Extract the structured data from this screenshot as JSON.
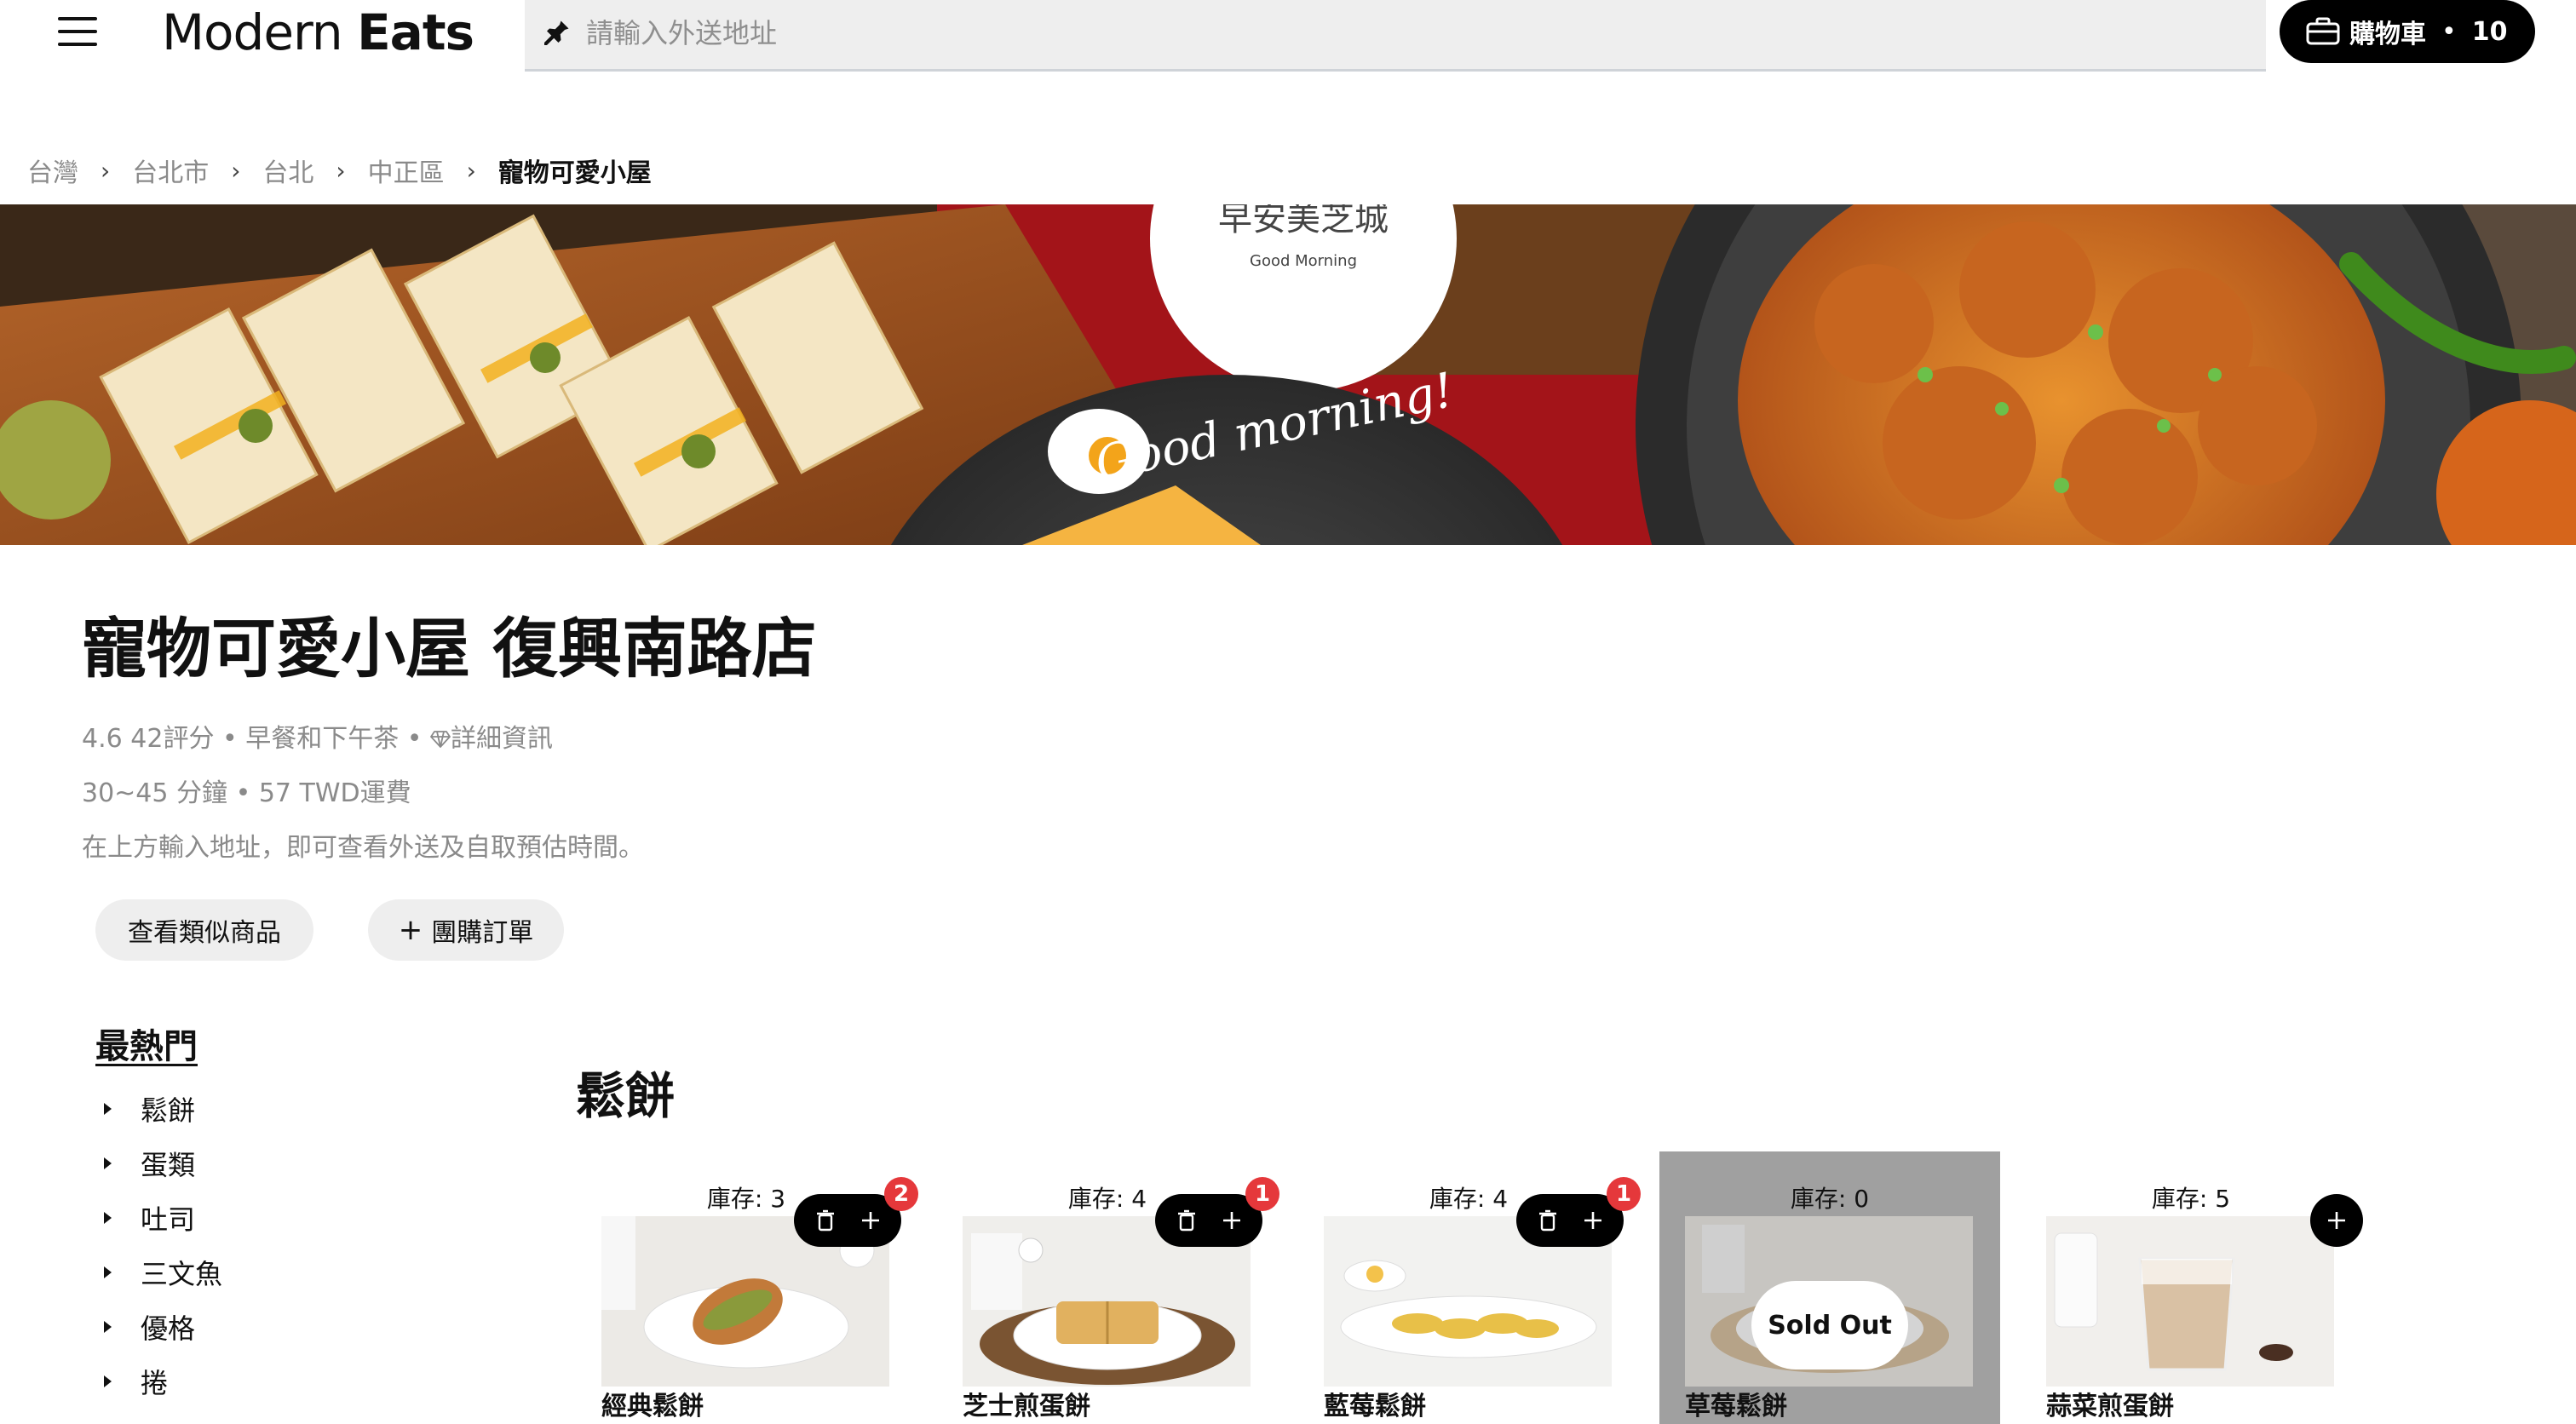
{
  "header": {
    "logo_light": "Modern",
    "logo_bold": "Eats",
    "search_placeholder": "請輸入外送地址",
    "cart_label": "購物車",
    "cart_separator": "•",
    "cart_count": "10"
  },
  "breadcrumb": {
    "items": [
      "台灣",
      "台北市",
      "台北",
      "中正區",
      "寵物可愛小屋"
    ]
  },
  "store": {
    "title": "寵物可愛小屋 復興南路店",
    "rating": "4.6",
    "reviews": "42評分",
    "sep": "•",
    "category": "早餐和下午茶",
    "details_label": "詳細資訊",
    "delivery_time": "30~45 分鐘",
    "delivery_fee": "57 TWD運費",
    "address_hint": "在上方輸入地址，即可查看外送及自取預估時間。"
  },
  "actions": {
    "similar_label": "查看類似商品",
    "group_label": "團購訂單",
    "group_prefix": "+"
  },
  "sidebar": {
    "title": "最熱門",
    "items": [
      {
        "label": "鬆餅"
      },
      {
        "label": "蛋類"
      },
      {
        "label": "吐司"
      },
      {
        "label": "三文魚"
      },
      {
        "label": "優格"
      },
      {
        "label": "捲"
      }
    ]
  },
  "section": {
    "title": "鬆餅",
    "sold_out_label": "Sold Out",
    "items": [
      {
        "name": "經典鬆餅",
        "stock": "庫存: 3",
        "in_cart": "2",
        "sold_out": false
      },
      {
        "name": "芝士煎蛋餅",
        "stock": "庫存: 4",
        "in_cart": "1",
        "sold_out": false
      },
      {
        "name": "藍莓鬆餅",
        "stock": "庫存: 4",
        "in_cart": "1",
        "sold_out": false
      },
      {
        "name": "草莓鬆餅",
        "stock": "庫存: 0",
        "in_cart": "",
        "sold_out": true
      },
      {
        "name": "蒜菜煎蛋餅",
        "stock": "庫存: 5",
        "in_cart": "",
        "sold_out": false
      }
    ]
  },
  "hero": {
    "sign_text": "早安美芝城",
    "sign_subtext": "Good Morning",
    "plate_text": "Good morning!"
  },
  "colors": {
    "badge": "#e5383b",
    "search_bg": "#eeeeee",
    "cart_bg": "#000000",
    "muted_text": "#8a8a8a"
  }
}
